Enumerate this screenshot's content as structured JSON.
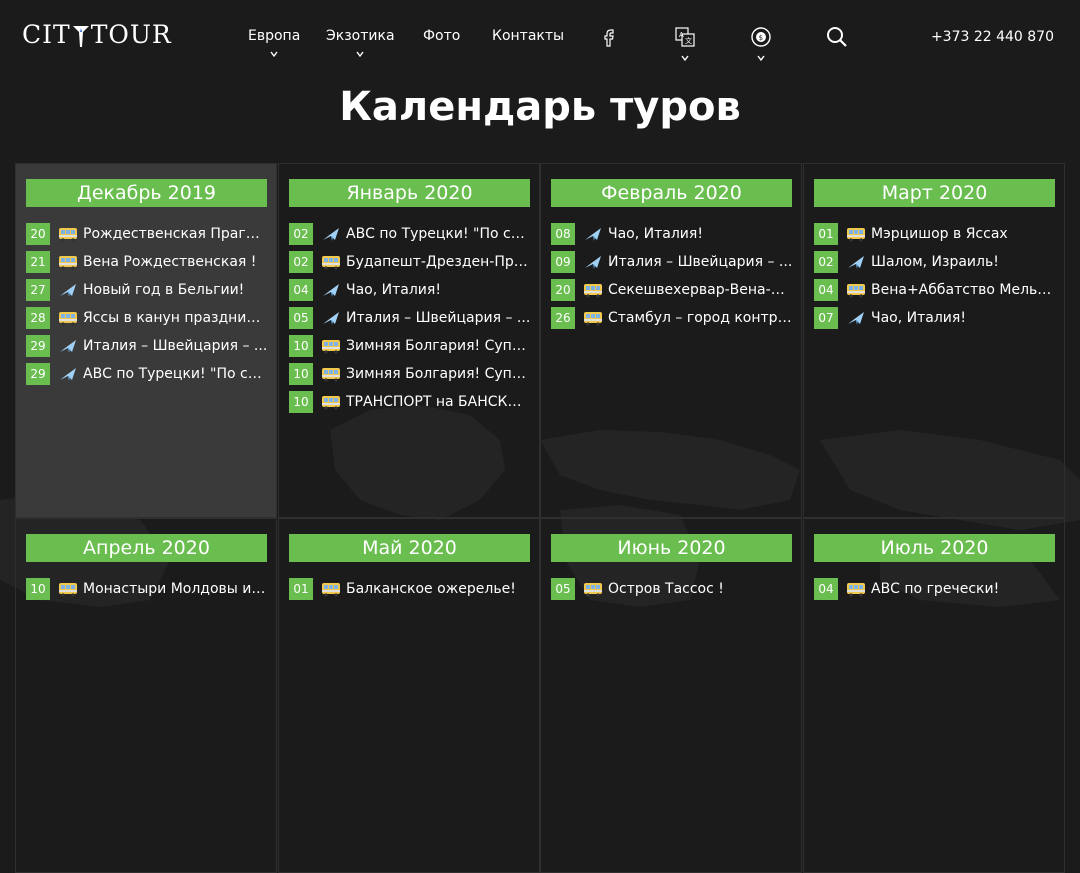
{
  "header": {
    "logo_text": "CITYTOUR",
    "logo_left": "CIT",
    "logo_right": "TOUR",
    "nav": [
      {
        "label": "Европа",
        "has_dropdown": true
      },
      {
        "label": "Экзотика",
        "has_dropdown": true
      },
      {
        "label": "Фото",
        "has_dropdown": false
      },
      {
        "label": "Контакты",
        "has_dropdown": false
      }
    ],
    "icons": [
      "facebook-icon",
      "translate-icon",
      "currency-icon",
      "search-icon"
    ],
    "phone": "+373 22 440 870"
  },
  "page_title": "Календарь туров",
  "colors": {
    "accent": "#6abe4f",
    "background": "#1b1b1b",
    "active_cell": "#3a3a3a"
  },
  "months": [
    {
      "title": "Декабрь 2019",
      "active": true,
      "tours": [
        {
          "day": "20",
          "icon": "bus-icon",
          "name": "Рождественская Прага...!"
        },
        {
          "day": "21",
          "icon": "bus-icon",
          "name": "Вена Рождественская !"
        },
        {
          "day": "27",
          "icon": "plane-icon",
          "name": "Новый год в Бельгии!"
        },
        {
          "day": "28",
          "icon": "bus-icon",
          "name": "Яссы в канун праздников"
        },
        {
          "day": "29",
          "icon": "plane-icon",
          "name": "Италия – Швейцария – ..."
        },
        {
          "day": "29",
          "icon": "plane-icon",
          "name": "АВС по Турецки! \"По сле..."
        }
      ]
    },
    {
      "title": "Январь 2020",
      "active": false,
      "tours": [
        {
          "day": "02",
          "icon": "plane-icon",
          "name": "АВС по Турецки! \"По сле..."
        },
        {
          "day": "02",
          "icon": "bus-icon",
          "name": "Будапешт-Дрезден-Праг..."
        },
        {
          "day": "04",
          "icon": "plane-icon",
          "name": "Чао, Италия!"
        },
        {
          "day": "05",
          "icon": "plane-icon",
          "name": "Италия – Швейцария – ..."
        },
        {
          "day": "10",
          "icon": "bus-icon",
          "name": "Зимняя Болгария! Супер..."
        },
        {
          "day": "10",
          "icon": "bus-icon",
          "name": "Зимняя Болгария! Супер..."
        },
        {
          "day": "10",
          "icon": "bus-icon",
          "name": "ТРАНСПОРТ на БАНСКО..."
        }
      ]
    },
    {
      "title": "Февраль 2020",
      "active": false,
      "tours": [
        {
          "day": "08",
          "icon": "plane-icon",
          "name": "Чао, Италия!"
        },
        {
          "day": "09",
          "icon": "plane-icon",
          "name": "Италия – Швейцария – ..."
        },
        {
          "day": "20",
          "icon": "bus-icon",
          "name": "Секешвехервар-Вена-Бу..."
        },
        {
          "day": "26",
          "icon": "bus-icon",
          "name": "Стамбул – город контрас..."
        }
      ]
    },
    {
      "title": "Март 2020",
      "active": false,
      "tours": [
        {
          "day": "01",
          "icon": "bus-icon",
          "name": "Мэрцишор в Яссах"
        },
        {
          "day": "02",
          "icon": "plane-icon",
          "name": "Шалом, Израиль!"
        },
        {
          "day": "04",
          "icon": "bus-icon",
          "name": "Вена+Аббатство Мельк ..."
        },
        {
          "day": "07",
          "icon": "plane-icon",
          "name": "Чао, Италия!"
        }
      ]
    },
    {
      "title": "Апрель 2020",
      "active": false,
      "tours": [
        {
          "day": "10",
          "icon": "bus-icon",
          "name": "Монастыри Молдовы и ..."
        }
      ]
    },
    {
      "title": "Май 2020",
      "active": false,
      "tours": [
        {
          "day": "01",
          "icon": "bus-icon",
          "name": "Балканское ожерелье!"
        }
      ]
    },
    {
      "title": "Июнь 2020",
      "active": false,
      "tours": [
        {
          "day": "05",
          "icon": "bus-icon",
          "name": "Остров Тассос !"
        }
      ]
    },
    {
      "title": "Июль 2020",
      "active": false,
      "tours": [
        {
          "day": "04",
          "icon": "bus-icon",
          "name": "АВС по гречески!"
        }
      ]
    }
  ]
}
